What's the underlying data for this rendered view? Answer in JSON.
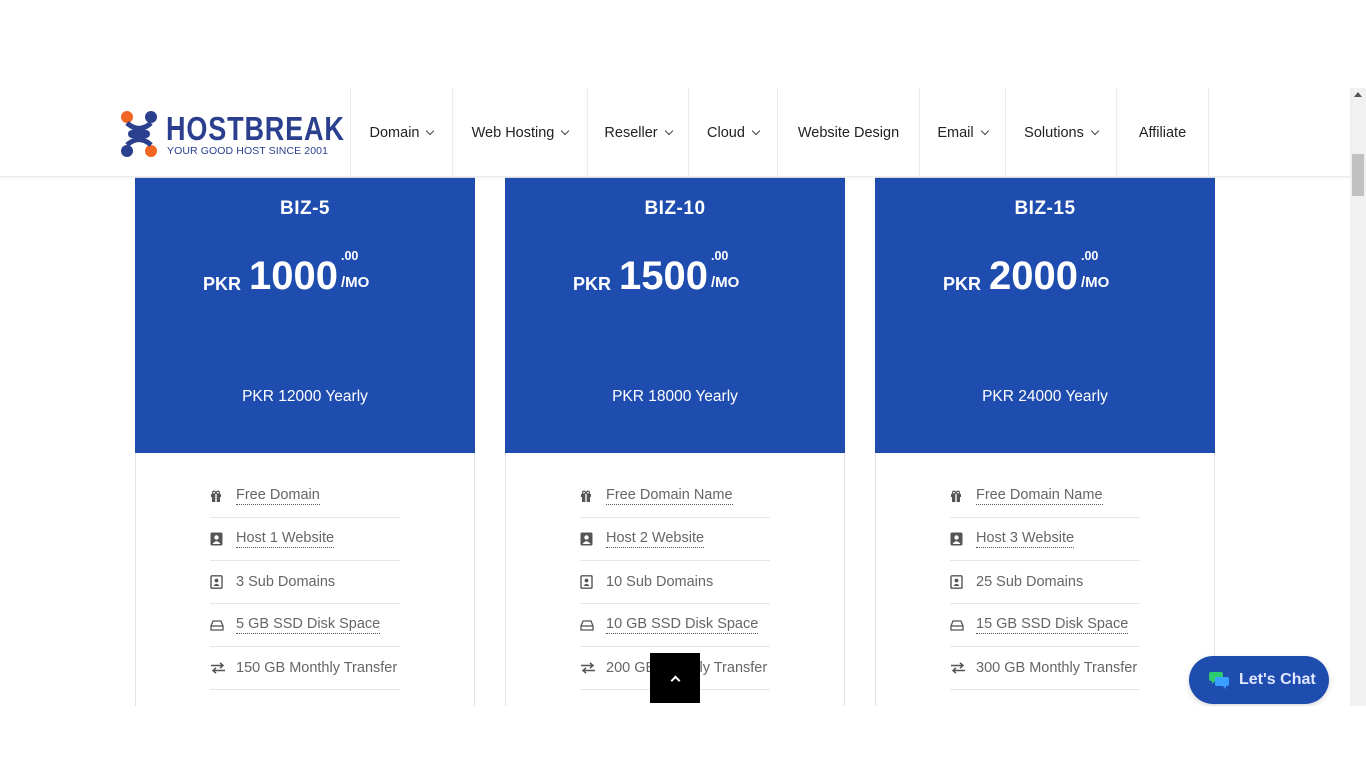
{
  "logo": {
    "name": "HOSTBREAK",
    "tagline": "YOUR GOOD HOST SINCE 2001"
  },
  "nav": [
    {
      "label": "Domain",
      "dropdown": true
    },
    {
      "label": "Web Hosting",
      "dropdown": true
    },
    {
      "label": "Reseller",
      "dropdown": true
    },
    {
      "label": "Cloud",
      "dropdown": true
    },
    {
      "label": "Website Design",
      "dropdown": false
    },
    {
      "label": "Email",
      "dropdown": true
    },
    {
      "label": "Solutions",
      "dropdown": true
    },
    {
      "label": "Affiliate",
      "dropdown": false
    }
  ],
  "plans": [
    {
      "name": "BIZ-5",
      "currency": "PKR",
      "amount": "1000",
      "cents": ".00",
      "period": "/MO",
      "yearly": "PKR 12000 Yearly",
      "features": [
        {
          "icon": "gift-icon",
          "text": "Free Domain",
          "dotted": true
        },
        {
          "icon": "contact-card-icon",
          "text": "Host 1 Website",
          "dotted": true
        },
        {
          "icon": "contact-book-icon",
          "text": "3 Sub Domains",
          "dotted": false
        },
        {
          "icon": "hard-drive-icon",
          "text": "5 GB SSD Disk Space",
          "dotted": true
        },
        {
          "icon": "transfer-arrows-icon",
          "text": "150 GB Monthly Transfer",
          "dotted": false
        }
      ]
    },
    {
      "name": "BIZ-10",
      "currency": "PKR",
      "amount": "1500",
      "cents": ".00",
      "period": "/MO",
      "yearly": "PKR 18000 Yearly",
      "features": [
        {
          "icon": "gift-icon",
          "text": "Free Domain Name",
          "dotted": true
        },
        {
          "icon": "contact-card-icon",
          "text": "Host 2 Website",
          "dotted": true
        },
        {
          "icon": "contact-book-icon",
          "text": "10 Sub Domains",
          "dotted": false
        },
        {
          "icon": "hard-drive-icon",
          "text": "10 GB SSD Disk Space",
          "dotted": true
        },
        {
          "icon": "transfer-arrows-icon",
          "text": "200 GB Monthly Transfer",
          "dotted": false
        }
      ]
    },
    {
      "name": "BIZ-15",
      "currency": "PKR",
      "amount": "2000",
      "cents": ".00",
      "period": "/MO",
      "yearly": "PKR 24000 Yearly",
      "features": [
        {
          "icon": "gift-icon",
          "text": "Free Domain Name",
          "dotted": true
        },
        {
          "icon": "contact-card-icon",
          "text": "Host 3 Website",
          "dotted": true
        },
        {
          "icon": "contact-book-icon",
          "text": "25 Sub Domains",
          "dotted": false
        },
        {
          "icon": "hard-drive-icon",
          "text": "15 GB SSD Disk Space",
          "dotted": true
        },
        {
          "icon": "transfer-arrows-icon",
          "text": "300 GB Monthly Transfer",
          "dotted": false
        }
      ]
    }
  ],
  "chat": {
    "label": "Let's Chat"
  },
  "colors": {
    "brand_blue": "#1f4caf",
    "logo_blue": "#2b3f8f",
    "logo_orange": "#f26522"
  }
}
